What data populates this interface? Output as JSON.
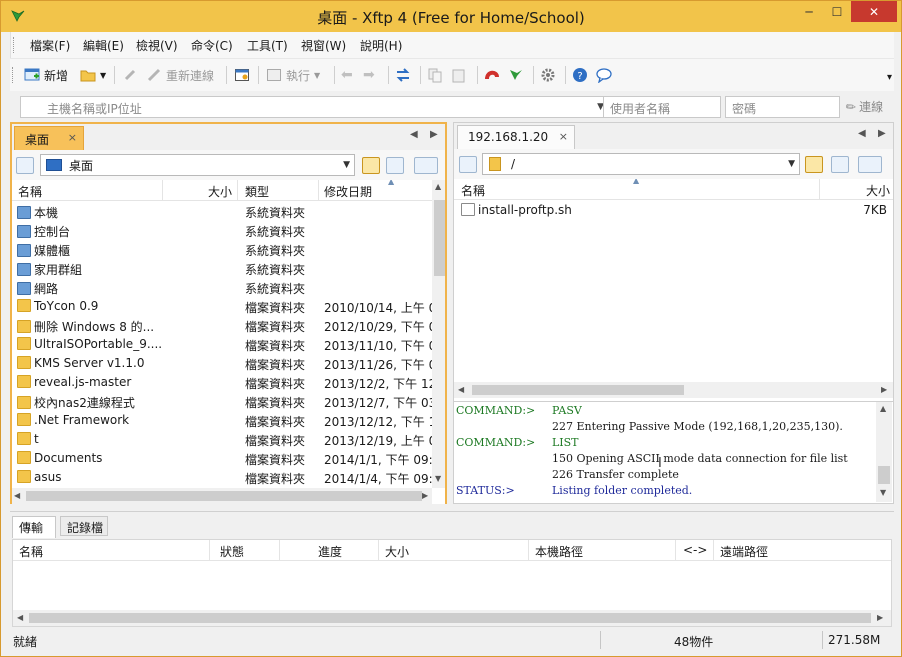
{
  "window": {
    "title": "桌面 - Xftp 4 (Free for Home/School)",
    "minimize": "─",
    "maximize": "☐",
    "close": "✕"
  },
  "menu": [
    "檔案(F)",
    "編輯(E)",
    "檢視(V)",
    "命令(C)",
    "工具(T)",
    "視窗(W)",
    "說明(H)"
  ],
  "toolbar": {
    "new_label": "新增",
    "reconnect_label": "重新連線",
    "execute_label": "執行",
    "overflow": "▾"
  },
  "address": {
    "host_placeholder": "主機名稱或IP位址",
    "user_placeholder": "使用者名稱",
    "password_placeholder": "密碼",
    "connect_label": "連線"
  },
  "local": {
    "tab_label": "桌面",
    "tab_close": "×",
    "path": "桌面",
    "columns": [
      "名稱",
      "大小",
      "類型",
      "修改日期"
    ],
    "rows": [
      {
        "name": "本機",
        "size": "",
        "type": "系統資料夾",
        "date": "",
        "icon": "computer-icon"
      },
      {
        "name": "控制台",
        "size": "",
        "type": "系統資料夾",
        "date": "",
        "icon": "control-panel-icon"
      },
      {
        "name": "媒體櫃",
        "size": "",
        "type": "系統資料夾",
        "date": "",
        "icon": "library-icon"
      },
      {
        "name": "家用群組",
        "size": "",
        "type": "系統資料夾",
        "date": "",
        "icon": "homegroup-icon"
      },
      {
        "name": "網路",
        "size": "",
        "type": "系統資料夾",
        "date": "",
        "icon": "network-icon"
      },
      {
        "name": "ToYcon 0.9",
        "size": "",
        "type": "檔案資料夾",
        "date": "2010/10/14, 上午 0",
        "icon": "folder-icon"
      },
      {
        "name": "刪除 Windows 8 的...",
        "size": "",
        "type": "檔案資料夾",
        "date": "2012/10/29, 下午 0",
        "icon": "folder-icon"
      },
      {
        "name": "UltraISOPortable_9....",
        "size": "",
        "type": "檔案資料夾",
        "date": "2013/11/10, 下午 0",
        "icon": "folder-icon"
      },
      {
        "name": "KMS Server v1.1.0",
        "size": "",
        "type": "檔案資料夾",
        "date": "2013/11/26, 下午 0",
        "icon": "folder-icon"
      },
      {
        "name": "reveal.js-master",
        "size": "",
        "type": "檔案資料夾",
        "date": "2013/12/2, 下午 12",
        "icon": "folder-icon"
      },
      {
        "name": "校內nas2連線程式",
        "size": "",
        "type": "檔案資料夾",
        "date": "2013/12/7, 下午 03",
        "icon": "folder-icon"
      },
      {
        "name": ".Net Framework",
        "size": "",
        "type": "檔案資料夾",
        "date": "2013/12/12, 下午 1",
        "icon": "folder-icon"
      },
      {
        "name": "t",
        "size": "",
        "type": "檔案資料夾",
        "date": "2013/12/19, 上午 0",
        "icon": "folder-icon"
      },
      {
        "name": "Documents",
        "size": "",
        "type": "檔案資料夾",
        "date": "2014/1/1, 下午 09:2",
        "icon": "folder-icon"
      },
      {
        "name": "asus",
        "size": "",
        "type": "檔案資料夾",
        "date": "2014/1/4, 下午 09:2",
        "icon": "folder-icon"
      }
    ]
  },
  "remote": {
    "tab_label": "192.168.1.20",
    "tab_close": "×",
    "path": "/",
    "columns": [
      "名稱",
      "大小"
    ],
    "rows": [
      {
        "name": "install-proftp.sh",
        "size": "7KB",
        "icon": "file-icon"
      }
    ]
  },
  "log": [
    {
      "key": "COMMAND:>",
      "text": "PASV",
      "kind": "cmd"
    },
    {
      "key": "",
      "text": "227 Entering Passive Mode (192,168,1,20,235,130).",
      "kind": "msg"
    },
    {
      "key": "COMMAND:>",
      "text": "LIST",
      "kind": "cmd"
    },
    {
      "key": "",
      "text": "150 Opening ASCII mode data connection for file list",
      "kind": "msg"
    },
    {
      "key": "",
      "text": "226 Transfer complete",
      "kind": "msg"
    },
    {
      "key": "STATUS:>",
      "text": "Listing folder completed.",
      "kind": "status"
    }
  ],
  "transfer": {
    "tab_transfer": "傳輸",
    "tab_log": "記錄檔",
    "columns": [
      "名稱",
      "狀態",
      "進度",
      "大小",
      "本機路徑",
      "<->",
      "遠端路徑"
    ]
  },
  "status": {
    "text": "就緒",
    "count": "48物件",
    "size": "271.58M"
  },
  "colors": {
    "title_bar": "#f2c44a",
    "active_tab": "#f7c15a",
    "log_command": "#1e7a24",
    "log_status": "#1f2a9a",
    "close_button": "#c7392e"
  }
}
